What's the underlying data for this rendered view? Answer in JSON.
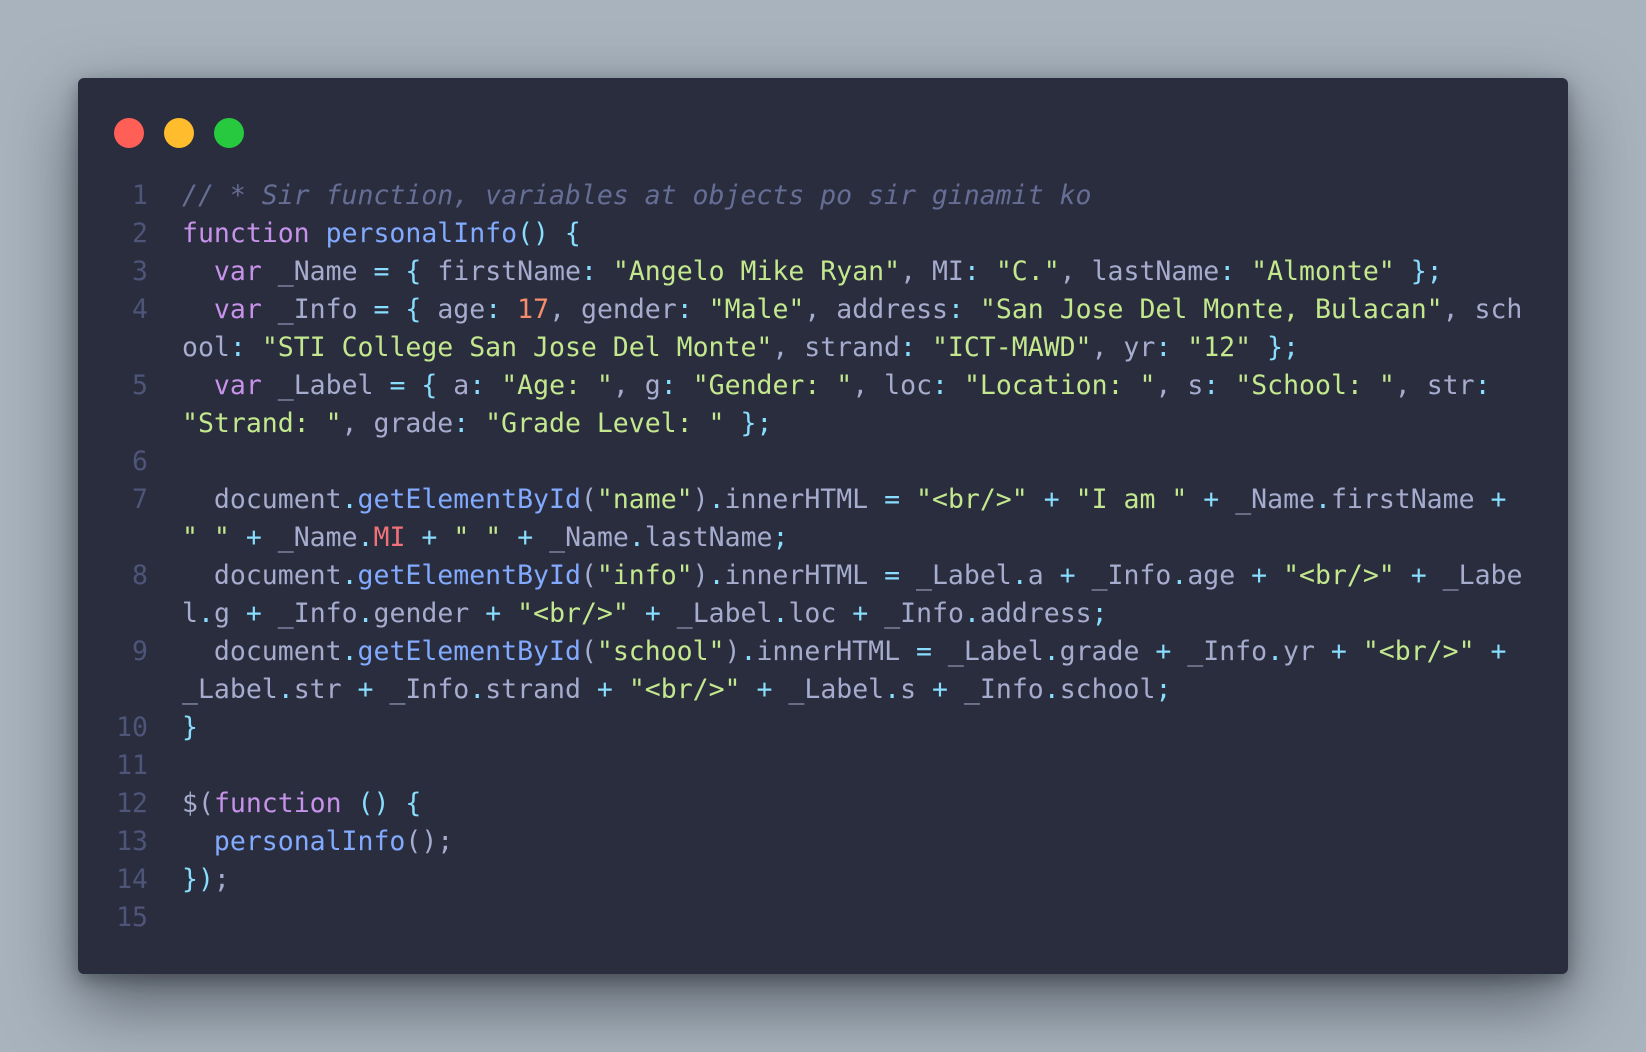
{
  "window": {
    "controls": [
      "close-dot",
      "minimize-dot",
      "maximize-dot"
    ]
  },
  "colors": {
    "background": "#a8b3bd",
    "editor_background": "#292d3e",
    "comment": "#676e95",
    "keyword": "#c792ea",
    "function": "#82aaff",
    "string": "#c3e88d",
    "number": "#f78c6c",
    "operator": "#89ddff",
    "plain": "#a6accd",
    "property_highlight": "#f07178",
    "line_number": "#4e5579"
  },
  "code": {
    "lines": [
      {
        "number": "1",
        "tokens": [
          {
            "t": "// * Sir function, variables at objects po sir ginamit ko",
            "c": "cm"
          }
        ]
      },
      {
        "number": "2",
        "tokens": [
          {
            "t": "function",
            "c": "kw"
          },
          {
            "t": " ",
            "c": "pl"
          },
          {
            "t": "personalInfo",
            "c": "fn"
          },
          {
            "t": "() {",
            "c": "op"
          }
        ]
      },
      {
        "number": "3",
        "tokens": [
          {
            "t": "  ",
            "c": "pl"
          },
          {
            "t": "var",
            "c": "kw"
          },
          {
            "t": " _Name ",
            "c": "pl"
          },
          {
            "t": "=",
            "c": "op"
          },
          {
            "t": " ",
            "c": "pl"
          },
          {
            "t": "{",
            "c": "op"
          },
          {
            "t": " firstName",
            "c": "pl"
          },
          {
            "t": ":",
            "c": "op"
          },
          {
            "t": " ",
            "c": "pl"
          },
          {
            "t": "\"Angelo Mike Ryan\"",
            "c": "str"
          },
          {
            "t": ", MI",
            "c": "pl"
          },
          {
            "t": ":",
            "c": "op"
          },
          {
            "t": " ",
            "c": "pl"
          },
          {
            "t": "\"C.\"",
            "c": "str"
          },
          {
            "t": ", lastName",
            "c": "pl"
          },
          {
            "t": ":",
            "c": "op"
          },
          {
            "t": " ",
            "c": "pl"
          },
          {
            "t": "\"Almonte\"",
            "c": "str"
          },
          {
            "t": " ",
            "c": "pl"
          },
          {
            "t": "};",
            "c": "op"
          }
        ]
      },
      {
        "number": "4",
        "tokens": [
          {
            "t": "  ",
            "c": "pl"
          },
          {
            "t": "var",
            "c": "kw"
          },
          {
            "t": " _Info ",
            "c": "pl"
          },
          {
            "t": "=",
            "c": "op"
          },
          {
            "t": " ",
            "c": "pl"
          },
          {
            "t": "{",
            "c": "op"
          },
          {
            "t": " age",
            "c": "pl"
          },
          {
            "t": ":",
            "c": "op"
          },
          {
            "t": " ",
            "c": "pl"
          },
          {
            "t": "17",
            "c": "num"
          },
          {
            "t": ", gender",
            "c": "pl"
          },
          {
            "t": ":",
            "c": "op"
          },
          {
            "t": " ",
            "c": "pl"
          },
          {
            "t": "\"Male\"",
            "c": "str"
          },
          {
            "t": ", address",
            "c": "pl"
          },
          {
            "t": ":",
            "c": "op"
          },
          {
            "t": " ",
            "c": "pl"
          },
          {
            "t": "\"San Jose Del Monte, Bulacan\"",
            "c": "str"
          },
          {
            "t": ", school",
            "c": "pl"
          },
          {
            "t": ":",
            "c": "op"
          },
          {
            "t": " ",
            "c": "pl"
          },
          {
            "t": "\"STI College San Jose Del Monte\"",
            "c": "str"
          },
          {
            "t": ", strand",
            "c": "pl"
          },
          {
            "t": ":",
            "c": "op"
          },
          {
            "t": " ",
            "c": "pl"
          },
          {
            "t": "\"ICT-MAWD\"",
            "c": "str"
          },
          {
            "t": ", yr",
            "c": "pl"
          },
          {
            "t": ":",
            "c": "op"
          },
          {
            "t": " ",
            "c": "pl"
          },
          {
            "t": "\"12\"",
            "c": "str"
          },
          {
            "t": " ",
            "c": "pl"
          },
          {
            "t": "};",
            "c": "op"
          }
        ]
      },
      {
        "number": "5",
        "tokens": [
          {
            "t": "  ",
            "c": "pl"
          },
          {
            "t": "var",
            "c": "kw"
          },
          {
            "t": " _Label ",
            "c": "pl"
          },
          {
            "t": "=",
            "c": "op"
          },
          {
            "t": " ",
            "c": "pl"
          },
          {
            "t": "{",
            "c": "op"
          },
          {
            "t": " a",
            "c": "pl"
          },
          {
            "t": ":",
            "c": "op"
          },
          {
            "t": " ",
            "c": "pl"
          },
          {
            "t": "\"Age: \"",
            "c": "str"
          },
          {
            "t": ", g",
            "c": "pl"
          },
          {
            "t": ":",
            "c": "op"
          },
          {
            "t": " ",
            "c": "pl"
          },
          {
            "t": "\"Gender: \"",
            "c": "str"
          },
          {
            "t": ", loc",
            "c": "pl"
          },
          {
            "t": ":",
            "c": "op"
          },
          {
            "t": " ",
            "c": "pl"
          },
          {
            "t": "\"Location: \"",
            "c": "str"
          },
          {
            "t": ", s",
            "c": "pl"
          },
          {
            "t": ":",
            "c": "op"
          },
          {
            "t": " ",
            "c": "pl"
          },
          {
            "t": "\"School: \"",
            "c": "str"
          },
          {
            "t": ", str",
            "c": "pl"
          },
          {
            "t": ":",
            "c": "op"
          },
          {
            "t": " ",
            "c": "pl"
          },
          {
            "t": "\"Strand: \"",
            "c": "str"
          },
          {
            "t": ", grade",
            "c": "pl"
          },
          {
            "t": ":",
            "c": "op"
          },
          {
            "t": " ",
            "c": "pl"
          },
          {
            "t": "\"Grade Level: \"",
            "c": "str"
          },
          {
            "t": " ",
            "c": "pl"
          },
          {
            "t": "};",
            "c": "op"
          }
        ]
      },
      {
        "number": "6",
        "tokens": []
      },
      {
        "number": "7",
        "tokens": [
          {
            "t": "  document",
            "c": "pl"
          },
          {
            "t": ".",
            "c": "op"
          },
          {
            "t": "getElementById",
            "c": "fn"
          },
          {
            "t": "(",
            "c": "pl"
          },
          {
            "t": "\"name\"",
            "c": "str"
          },
          {
            "t": ")",
            "c": "pl"
          },
          {
            "t": ".",
            "c": "op"
          },
          {
            "t": "innerHTML ",
            "c": "pl"
          },
          {
            "t": "=",
            "c": "op"
          },
          {
            "t": " ",
            "c": "pl"
          },
          {
            "t": "\"<br/>\"",
            "c": "str"
          },
          {
            "t": " ",
            "c": "pl"
          },
          {
            "t": "+",
            "c": "op"
          },
          {
            "t": " ",
            "c": "pl"
          },
          {
            "t": "\"I am \"",
            "c": "str"
          },
          {
            "t": " ",
            "c": "pl"
          },
          {
            "t": "+",
            "c": "op"
          },
          {
            "t": " _Name",
            "c": "pl"
          },
          {
            "t": ".",
            "c": "op"
          },
          {
            "t": "firstName ",
            "c": "pl"
          },
          {
            "t": "+",
            "c": "op"
          },
          {
            "t": " ",
            "c": "pl"
          },
          {
            "t": "\" \"",
            "c": "str"
          },
          {
            "t": " ",
            "c": "pl"
          },
          {
            "t": "+",
            "c": "op"
          },
          {
            "t": " _Name",
            "c": "pl"
          },
          {
            "t": ".",
            "c": "op"
          },
          {
            "t": "MI",
            "c": "pr"
          },
          {
            "t": " ",
            "c": "pl"
          },
          {
            "t": "+",
            "c": "op"
          },
          {
            "t": " ",
            "c": "pl"
          },
          {
            "t": "\" \"",
            "c": "str"
          },
          {
            "t": " ",
            "c": "pl"
          },
          {
            "t": "+",
            "c": "op"
          },
          {
            "t": " _Name",
            "c": "pl"
          },
          {
            "t": ".",
            "c": "op"
          },
          {
            "t": "lastName",
            "c": "pl"
          },
          {
            "t": ";",
            "c": "op"
          }
        ]
      },
      {
        "number": "8",
        "tokens": [
          {
            "t": "  document",
            "c": "pl"
          },
          {
            "t": ".",
            "c": "op"
          },
          {
            "t": "getElementById",
            "c": "fn"
          },
          {
            "t": "(",
            "c": "pl"
          },
          {
            "t": "\"info\"",
            "c": "str"
          },
          {
            "t": ")",
            "c": "pl"
          },
          {
            "t": ".",
            "c": "op"
          },
          {
            "t": "innerHTML ",
            "c": "pl"
          },
          {
            "t": "=",
            "c": "op"
          },
          {
            "t": " _Label",
            "c": "pl"
          },
          {
            "t": ".",
            "c": "op"
          },
          {
            "t": "a ",
            "c": "pl"
          },
          {
            "t": "+",
            "c": "op"
          },
          {
            "t": " _Info",
            "c": "pl"
          },
          {
            "t": ".",
            "c": "op"
          },
          {
            "t": "age ",
            "c": "pl"
          },
          {
            "t": "+",
            "c": "op"
          },
          {
            "t": " ",
            "c": "pl"
          },
          {
            "t": "\"<br/>\"",
            "c": "str"
          },
          {
            "t": " ",
            "c": "pl"
          },
          {
            "t": "+",
            "c": "op"
          },
          {
            "t": " _Label",
            "c": "pl"
          },
          {
            "t": ".",
            "c": "op"
          },
          {
            "t": "g ",
            "c": "pl"
          },
          {
            "t": "+",
            "c": "op"
          },
          {
            "t": " _Info",
            "c": "pl"
          },
          {
            "t": ".",
            "c": "op"
          },
          {
            "t": "gender ",
            "c": "pl"
          },
          {
            "t": "+",
            "c": "op"
          },
          {
            "t": " ",
            "c": "pl"
          },
          {
            "t": "\"<br/>\"",
            "c": "str"
          },
          {
            "t": " ",
            "c": "pl"
          },
          {
            "t": "+",
            "c": "op"
          },
          {
            "t": " _Label",
            "c": "pl"
          },
          {
            "t": ".",
            "c": "op"
          },
          {
            "t": "loc ",
            "c": "pl"
          },
          {
            "t": "+",
            "c": "op"
          },
          {
            "t": " _Info",
            "c": "pl"
          },
          {
            "t": ".",
            "c": "op"
          },
          {
            "t": "address",
            "c": "pl"
          },
          {
            "t": ";",
            "c": "op"
          }
        ]
      },
      {
        "number": "9",
        "tokens": [
          {
            "t": "  document",
            "c": "pl"
          },
          {
            "t": ".",
            "c": "op"
          },
          {
            "t": "getElementById",
            "c": "fn"
          },
          {
            "t": "(",
            "c": "pl"
          },
          {
            "t": "\"school\"",
            "c": "str"
          },
          {
            "t": ")",
            "c": "pl"
          },
          {
            "t": ".",
            "c": "op"
          },
          {
            "t": "innerHTML ",
            "c": "pl"
          },
          {
            "t": "=",
            "c": "op"
          },
          {
            "t": " _Label",
            "c": "pl"
          },
          {
            "t": ".",
            "c": "op"
          },
          {
            "t": "grade ",
            "c": "pl"
          },
          {
            "t": "+",
            "c": "op"
          },
          {
            "t": " _Info",
            "c": "pl"
          },
          {
            "t": ".",
            "c": "op"
          },
          {
            "t": "yr ",
            "c": "pl"
          },
          {
            "t": "+",
            "c": "op"
          },
          {
            "t": " ",
            "c": "pl"
          },
          {
            "t": "\"<br/>\"",
            "c": "str"
          },
          {
            "t": " ",
            "c": "pl"
          },
          {
            "t": "+",
            "c": "op"
          },
          {
            "t": " _Label",
            "c": "pl"
          },
          {
            "t": ".",
            "c": "op"
          },
          {
            "t": "str ",
            "c": "pl"
          },
          {
            "t": "+",
            "c": "op"
          },
          {
            "t": " _Info",
            "c": "pl"
          },
          {
            "t": ".",
            "c": "op"
          },
          {
            "t": "strand ",
            "c": "pl"
          },
          {
            "t": "+",
            "c": "op"
          },
          {
            "t": " ",
            "c": "pl"
          },
          {
            "t": "\"<br/>\"",
            "c": "str"
          },
          {
            "t": " ",
            "c": "pl"
          },
          {
            "t": "+",
            "c": "op"
          },
          {
            "t": " _Label",
            "c": "pl"
          },
          {
            "t": ".",
            "c": "op"
          },
          {
            "t": "s ",
            "c": "pl"
          },
          {
            "t": "+",
            "c": "op"
          },
          {
            "t": " _Info",
            "c": "pl"
          },
          {
            "t": ".",
            "c": "op"
          },
          {
            "t": "school",
            "c": "pl"
          },
          {
            "t": ";",
            "c": "op"
          }
        ]
      },
      {
        "number": "10",
        "tokens": [
          {
            "t": "}",
            "c": "op"
          }
        ]
      },
      {
        "number": "11",
        "tokens": []
      },
      {
        "number": "12",
        "tokens": [
          {
            "t": "$",
            "c": "pl"
          },
          {
            "t": "(",
            "c": "pl"
          },
          {
            "t": "function",
            "c": "kw"
          },
          {
            "t": " ",
            "c": "pl"
          },
          {
            "t": "() {",
            "c": "op"
          }
        ]
      },
      {
        "number": "13",
        "tokens": [
          {
            "t": "  ",
            "c": "pl"
          },
          {
            "t": "personalInfo",
            "c": "fn"
          },
          {
            "t": "();",
            "c": "pl"
          }
        ]
      },
      {
        "number": "14",
        "tokens": [
          {
            "t": "})",
            "c": "op"
          },
          {
            "t": ";",
            "c": "pl"
          }
        ]
      },
      {
        "number": "15",
        "tokens": []
      }
    ]
  }
}
